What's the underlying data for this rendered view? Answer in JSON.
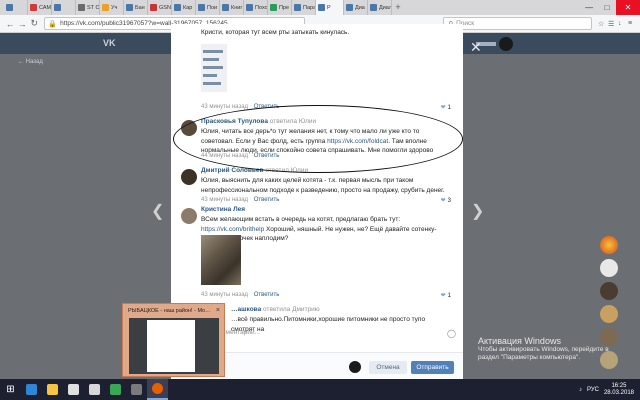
{
  "browser": {
    "tabs": [
      {
        "label": "",
        "color": "#4a76a8"
      },
      {
        "label": "САМ",
        "color": "#d23a3a"
      },
      {
        "label": "",
        "color": "#4a76a8"
      },
      {
        "label": "ST Ol",
        "color": "#6a6a6a"
      },
      {
        "label": "Уч",
        "color": "#f0a020"
      },
      {
        "label": "Бан",
        "color": "#4a76a8"
      },
      {
        "label": "GSN",
        "color": "#c33"
      },
      {
        "label": "Кар",
        "color": "#4a76a8"
      },
      {
        "label": "Пои",
        "color": "#4a76a8"
      },
      {
        "label": "Книг",
        "color": "#4a76a8"
      },
      {
        "label": "Похо",
        "color": "#4a76a8"
      },
      {
        "label": "Пре",
        "color": "#2a9d5c"
      },
      {
        "label": "Пара",
        "color": "#4a76a8"
      },
      {
        "label": "Р",
        "color": "#4a76a8",
        "active": true
      },
      {
        "label": "Диа",
        "color": "#4a76a8"
      },
      {
        "label": "Диал",
        "color": "#4a76a8"
      }
    ],
    "url": "https://vk.com/public31967057?w=wall-31967057_156245",
    "search_placeholder": "Поиск",
    "new_tab": "+"
  },
  "vk": {
    "logo": "VK",
    "back_label": "Назад"
  },
  "comments": [
    {
      "author": "",
      "replied_to": "",
      "text": "Кристи, которая тут всем рты затыкать кинулась.",
      "time": "43 минуты назад",
      "reply": "Ответить",
      "likes": "1"
    },
    {
      "author": "Прасковья Тупулова",
      "replied_to": "ответила Юлии",
      "text": "Юлия, читать все дерь*о тут желания нет, к тому что мало ли уже кто то советовал. Если у Вас фолд, есть группа ",
      "link": "https://vk.com/foldcat",
      "text_after": ". Там вполне нормальные люди, если спокойно совета спрашивать. Мне помогли здорово",
      "time": "44 минуты назад",
      "reply": "Ответить",
      "likes": ""
    },
    {
      "author": "Дмитрий Соловьев",
      "replied_to": "ответил Юлии",
      "text": "Юлия, выяснить для каких целей котята - т.к. первая мысль при таком непрофессиональном подходе к разведению, просто на продажу, срубить денег.",
      "time": "43 минуты назад",
      "reply": "Ответить",
      "likes": "3"
    },
    {
      "author": "Кристина Лея",
      "replied_to": "",
      "text": "ВСем желающим встать в очередь на котят, предлагаю брать тут: ",
      "link": "https://vk.com/brithelp",
      "text_after": " Хороший, няшный. Не нужен, не? Ещё давайте сотенку-другую котяточек наплодим?",
      "time": "43 минуты назад",
      "reply": "Ответить",
      "likes": "1"
    },
    {
      "author": "…ашкова",
      "replied_to": "ответила Дмитрию",
      "text": "…всё правильно.Питомники,хорошие питомники не просто тупо смотрят на",
      "time": "",
      "reply": "",
      "likes": ""
    }
  ],
  "compose": {
    "placeholder": "…ш комментарий...",
    "cancel": "Отмена",
    "send": "Отправить"
  },
  "preview": {
    "title": "РЫБАЦКОЕ - наш район! - Mo…",
    "close": "×"
  },
  "windows": {
    "activation_title": "Активация Windows",
    "activation_text": "Чтобы активировать Windows, перейдите в раздел \"Параметры компьютера\".",
    "time": "16:25",
    "date": "28.03.2018",
    "lang": "РУС"
  },
  "colors": {
    "vk_link": "#2a5885",
    "vk_button": "#5181b8",
    "taskbar": "#1d2030"
  }
}
